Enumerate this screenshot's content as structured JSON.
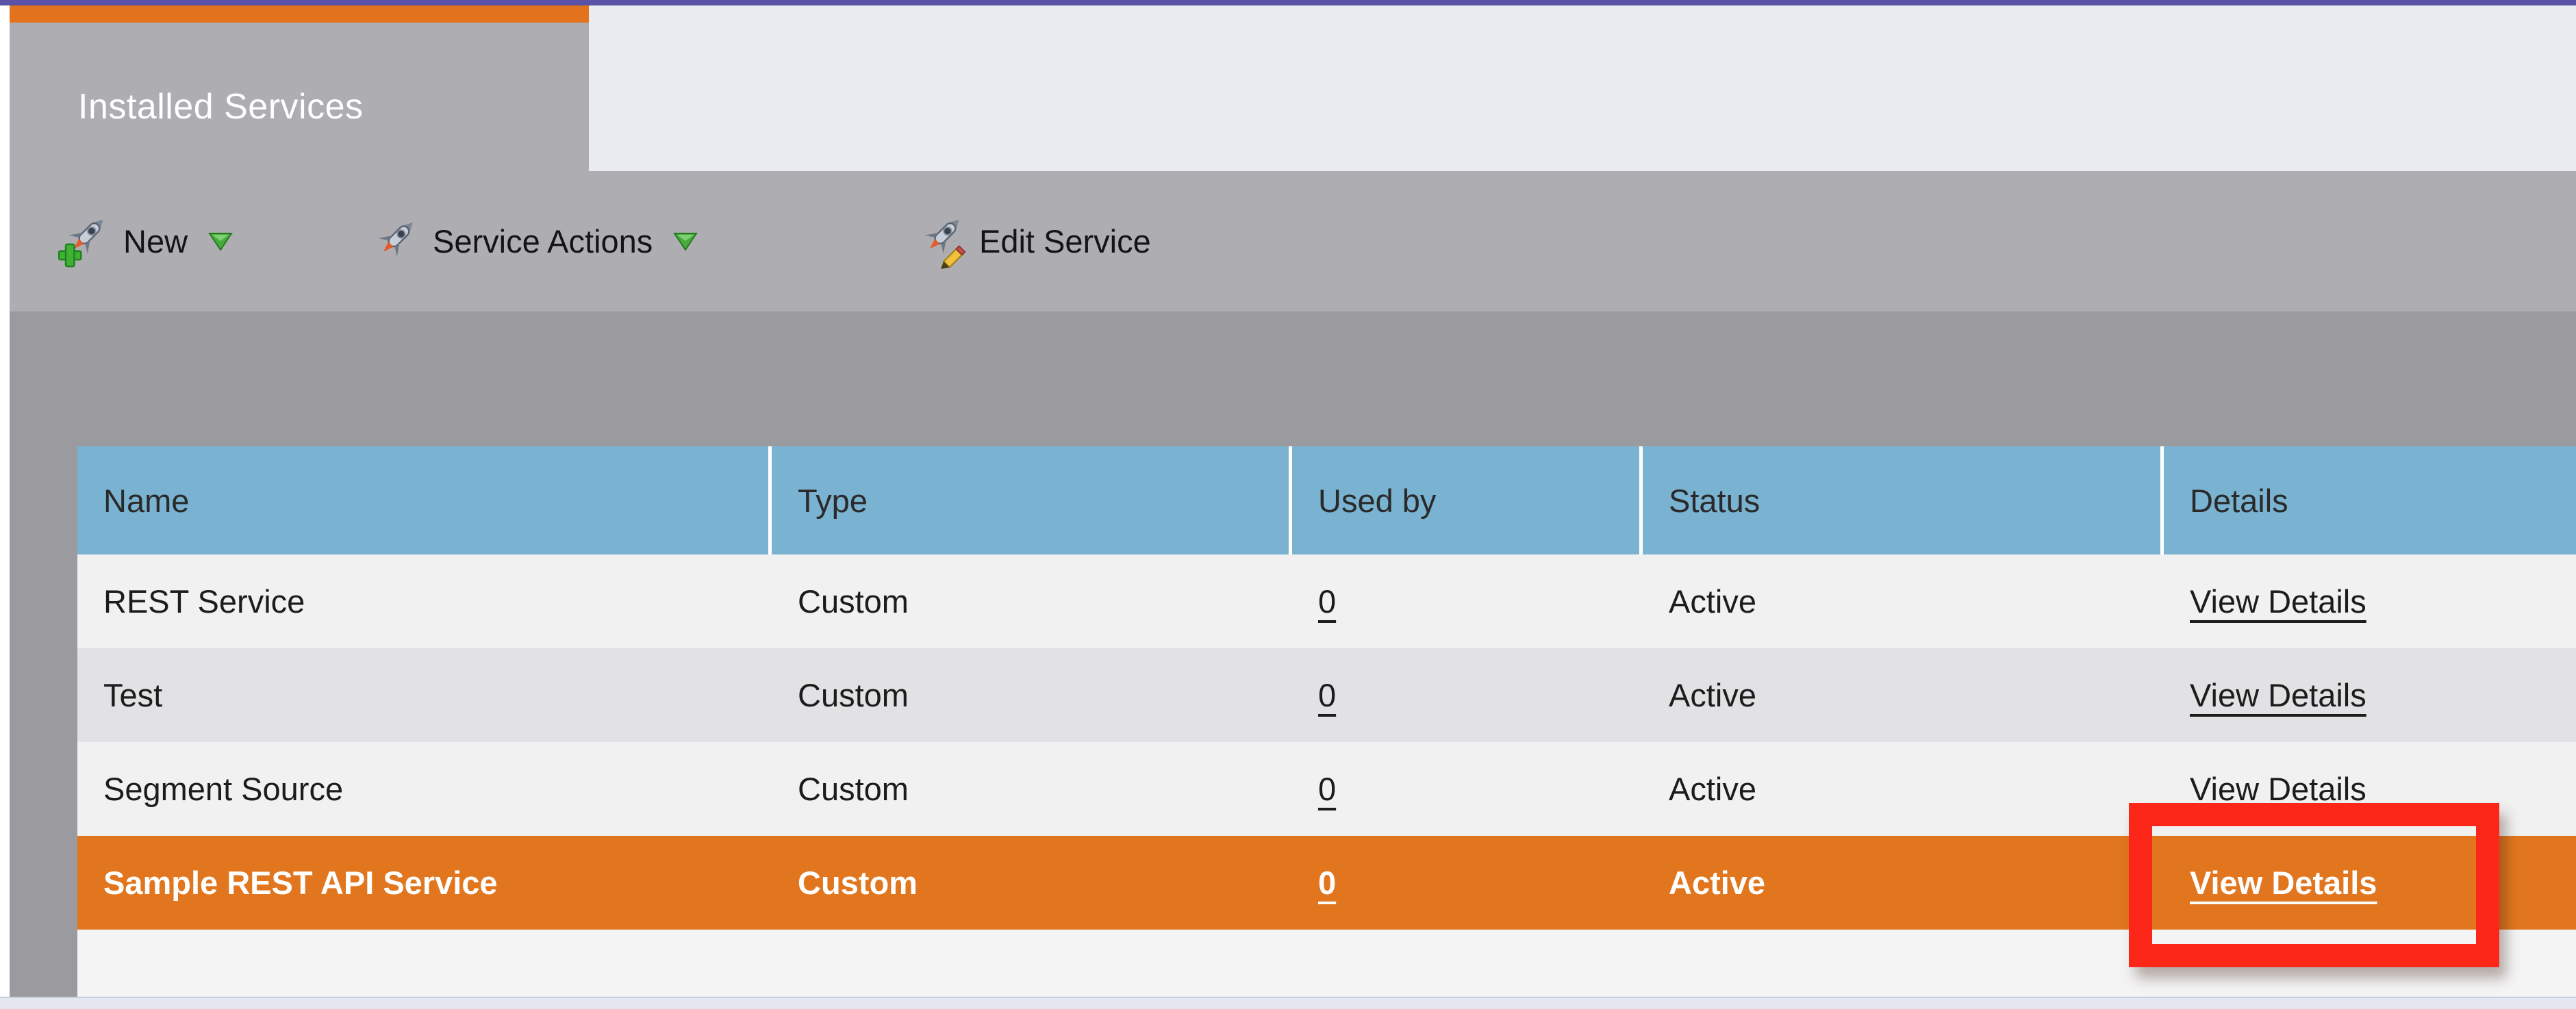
{
  "tab": {
    "title": "Installed Services"
  },
  "toolbar": {
    "buttons": [
      {
        "label": "New",
        "icon": "rocket-new-icon",
        "has_dropdown": true
      },
      {
        "label": "Service Actions",
        "icon": "rocket-actions-icon",
        "has_dropdown": true
      },
      {
        "label": "Edit Service",
        "icon": "rocket-edit-icon",
        "has_dropdown": false
      }
    ]
  },
  "table": {
    "columns": [
      {
        "label": "Name"
      },
      {
        "label": "Type"
      },
      {
        "label": "Used by"
      },
      {
        "label": "Status"
      },
      {
        "label": "Details"
      }
    ],
    "rows": [
      {
        "name": "REST Service",
        "type": "Custom",
        "used_by": "0",
        "status": "Active",
        "details": "View Details",
        "selected": false
      },
      {
        "name": "Test",
        "type": "Custom",
        "used_by": "0",
        "status": "Active",
        "details": "View Details",
        "selected": false
      },
      {
        "name": "Segment Source",
        "type": "Custom",
        "used_by": "0",
        "status": "Active",
        "details": "View Details",
        "selected": false
      },
      {
        "name": "Sample REST API Service",
        "type": "Custom",
        "used_by": "0",
        "status": "Active",
        "details": "View Details",
        "selected": true
      }
    ]
  },
  "annotation": {
    "type": "highlight-box",
    "target": "View Details link of Sample REST API Service row"
  },
  "colors": {
    "top_line_purple": "#5952a6",
    "top_bar_orange": "#e3721c",
    "tab_gray": "#aeaeb2",
    "band_gray": "#9b9b9f",
    "header_blue": "#7ab2d1",
    "row_light": "#f1f1f2",
    "row_mid": "#e2e2e4",
    "selected_row_orange": "#e2761f",
    "highlight_red": "#fc2718",
    "lavender": "#ebebf2"
  }
}
